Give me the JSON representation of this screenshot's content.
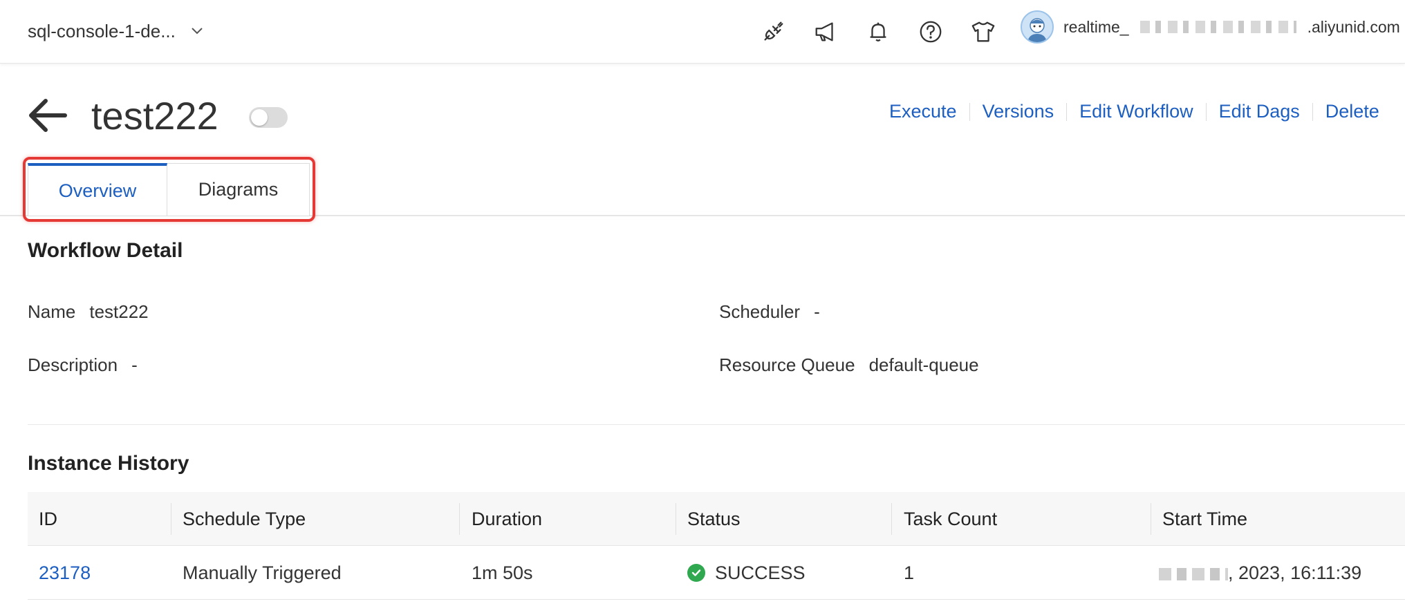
{
  "topbar": {
    "workspace": "sql-console-1-de...",
    "icons": [
      "plug-icon",
      "megaphone-icon",
      "bell-icon",
      "help-icon",
      "tshirt-icon"
    ],
    "user": {
      "prefix": "realtime_",
      "suffix": ".aliyunid.com"
    }
  },
  "header": {
    "title": "test222",
    "actions": [
      "Execute",
      "Versions",
      "Edit Workflow",
      "Edit Dags",
      "Delete"
    ]
  },
  "tabs": [
    {
      "label": "Overview",
      "active": true
    },
    {
      "label": "Diagrams",
      "active": false
    }
  ],
  "workflow_detail": {
    "title": "Workflow Detail",
    "name_label": "Name",
    "name_value": "test222",
    "description_label": "Description",
    "description_value": "-",
    "scheduler_label": "Scheduler",
    "scheduler_value": "-",
    "queue_label": "Resource Queue",
    "queue_value": "default-queue"
  },
  "instance_history": {
    "title": "Instance History",
    "columns": [
      "ID",
      "Schedule Type",
      "Duration",
      "Status",
      "Task Count",
      "Start Time"
    ],
    "rows": [
      {
        "id": "23178",
        "schedule_type": "Manually Triggered",
        "duration": "1m 50s",
        "status": "SUCCESS",
        "task_count": "1",
        "start_time": ", 2023, 16:11:39"
      }
    ]
  },
  "colors": {
    "accent": "#1d5fc1",
    "highlight": "#e53935",
    "success": "#2fa84f"
  }
}
